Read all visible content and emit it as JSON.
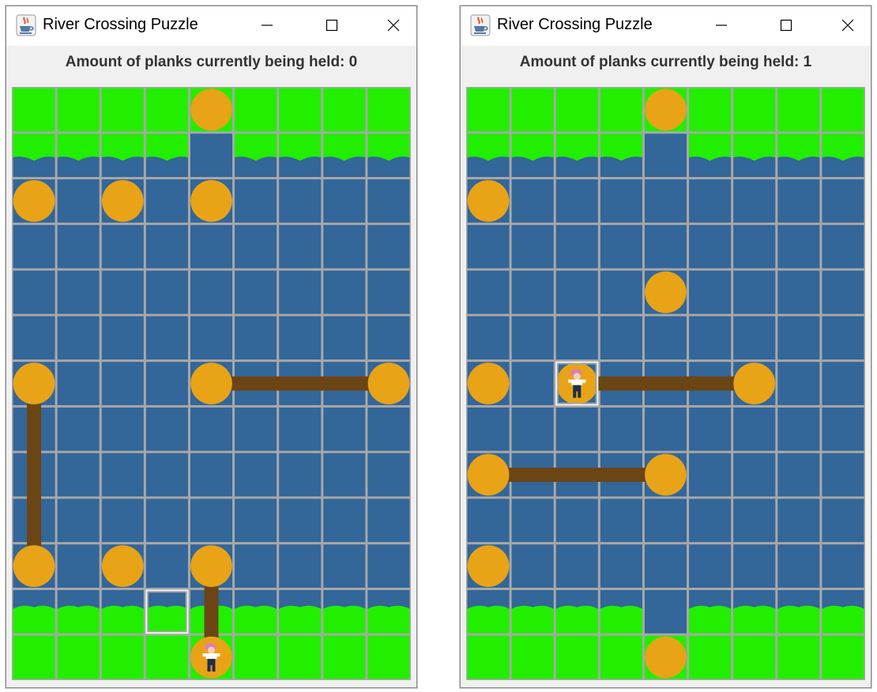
{
  "windows": [
    {
      "title": "River Crossing Puzzle",
      "status": "Amount of planks currently being held: 0",
      "planks_held": 0,
      "cols": 9,
      "rows": 13,
      "bank_rows": [
        0,
        12
      ],
      "shore_cols": {
        "1": [
          0,
          1,
          2,
          3,
          5,
          6,
          7,
          8
        ],
        "11": [
          0,
          1,
          2,
          3,
          4,
          5,
          6,
          7,
          8
        ]
      },
      "stumps": [
        [
          0,
          4
        ],
        [
          2,
          0
        ],
        [
          2,
          2
        ],
        [
          2,
          4
        ],
        [
          6,
          0
        ],
        [
          6,
          4
        ],
        [
          6,
          8
        ],
        [
          10,
          0
        ],
        [
          10,
          2
        ],
        [
          10,
          4
        ],
        [
          12,
          4
        ]
      ],
      "planks": [
        {
          "orientation": "horizontal",
          "row": 6,
          "from": 4,
          "to": 8
        },
        {
          "orientation": "vertical",
          "col": 0,
          "from": 6,
          "to": 10
        },
        {
          "orientation": "vertical",
          "col": 4,
          "from": 10,
          "to": 12
        }
      ],
      "player": [
        12,
        4
      ],
      "highlight": [
        11,
        3
      ]
    },
    {
      "title": "River Crossing Puzzle",
      "status": "Amount of planks currently being held: 1",
      "planks_held": 1,
      "cols": 9,
      "rows": 13,
      "bank_rows": [
        0,
        12
      ],
      "shore_cols": {
        "1": [
          0,
          1,
          2,
          3,
          5,
          6,
          7,
          8
        ],
        "11": [
          0,
          1,
          2,
          3,
          5,
          6,
          7,
          8
        ]
      },
      "stumps": [
        [
          0,
          4
        ],
        [
          2,
          0
        ],
        [
          4,
          4
        ],
        [
          6,
          0
        ],
        [
          6,
          2
        ],
        [
          6,
          6
        ],
        [
          8,
          0
        ],
        [
          8,
          4
        ],
        [
          10,
          0
        ],
        [
          12,
          4
        ]
      ],
      "planks": [
        {
          "orientation": "horizontal",
          "row": 6,
          "from": 2,
          "to": 6
        },
        {
          "orientation": "horizontal",
          "row": 8,
          "from": 0,
          "to": 4
        }
      ],
      "player": [
        6,
        2
      ],
      "highlight": [
        6,
        2
      ]
    }
  ],
  "colors": {
    "grass": "#22ee00",
    "water": "#336699",
    "stump": "#e8a317",
    "plank": "#6b4513",
    "grid": "#a8a8a8"
  },
  "icons": {
    "app": "java-coffee-cup-icon",
    "minimize": "minimize-icon",
    "maximize": "maximize-icon",
    "close": "close-icon"
  }
}
